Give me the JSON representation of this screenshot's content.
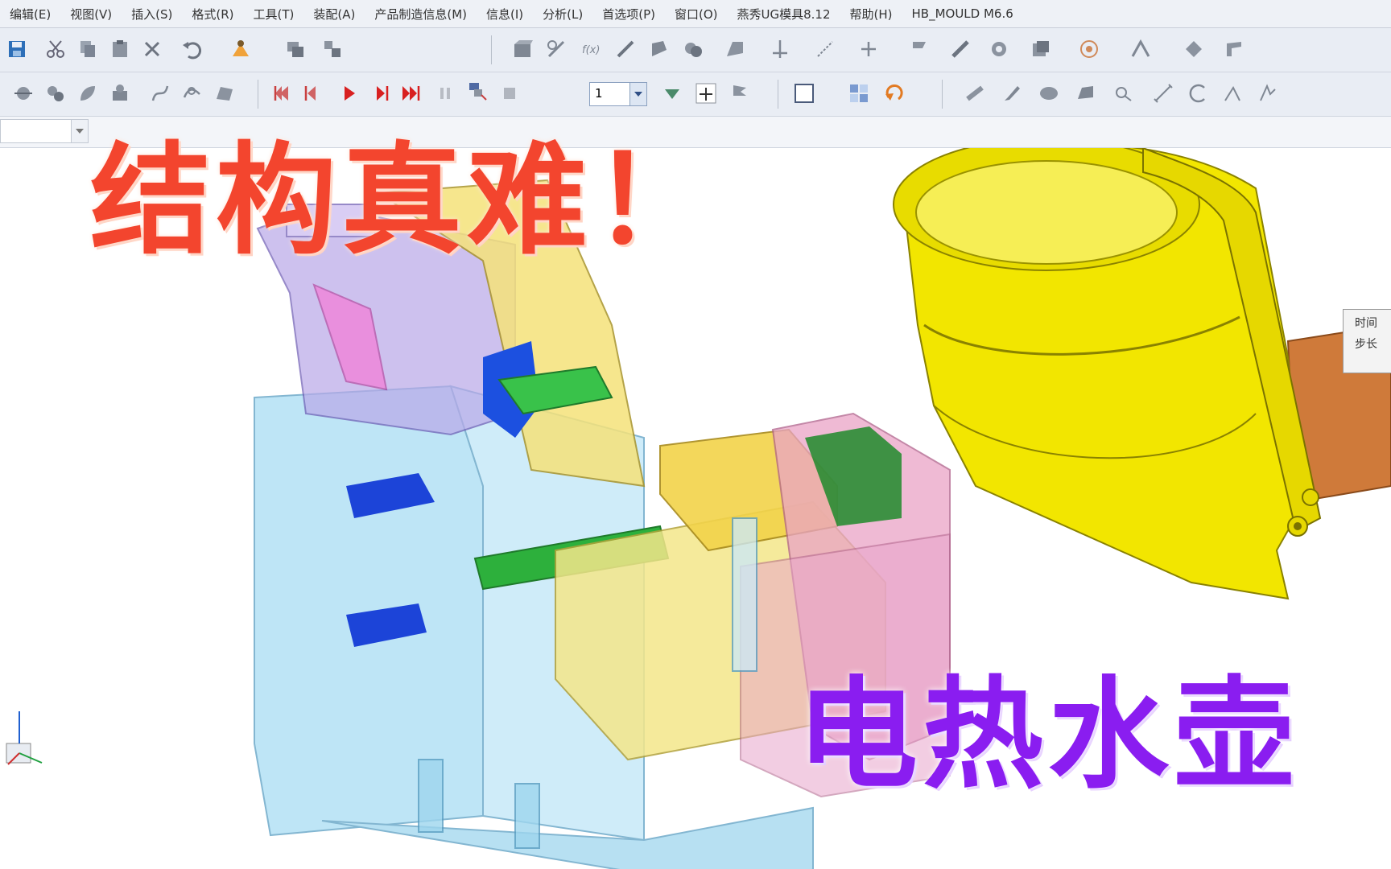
{
  "menu": {
    "items": [
      "编辑(E)",
      "视图(V)",
      "插入(S)",
      "格式(R)",
      "工具(T)",
      "装配(A)",
      "产品制造信息(M)",
      "信息(I)",
      "分析(L)",
      "首选项(P)",
      "窗口(O)",
      "燕秀UG模具8.12",
      "帮助(H)",
      "HB_MOULD M6.6"
    ]
  },
  "toolbar": {
    "step_value": "1"
  },
  "side_panel": {
    "line1": "时间",
    "line2": "步长"
  },
  "overlay": {
    "title_top": "结构真难！",
    "title_bottom": "电热水壶"
  },
  "colors": {
    "caption_red": "#f3452e",
    "caption_purple": "#8a1df0",
    "part_yellow": "#f2e600",
    "mould_blue": "#8fd3f0"
  }
}
